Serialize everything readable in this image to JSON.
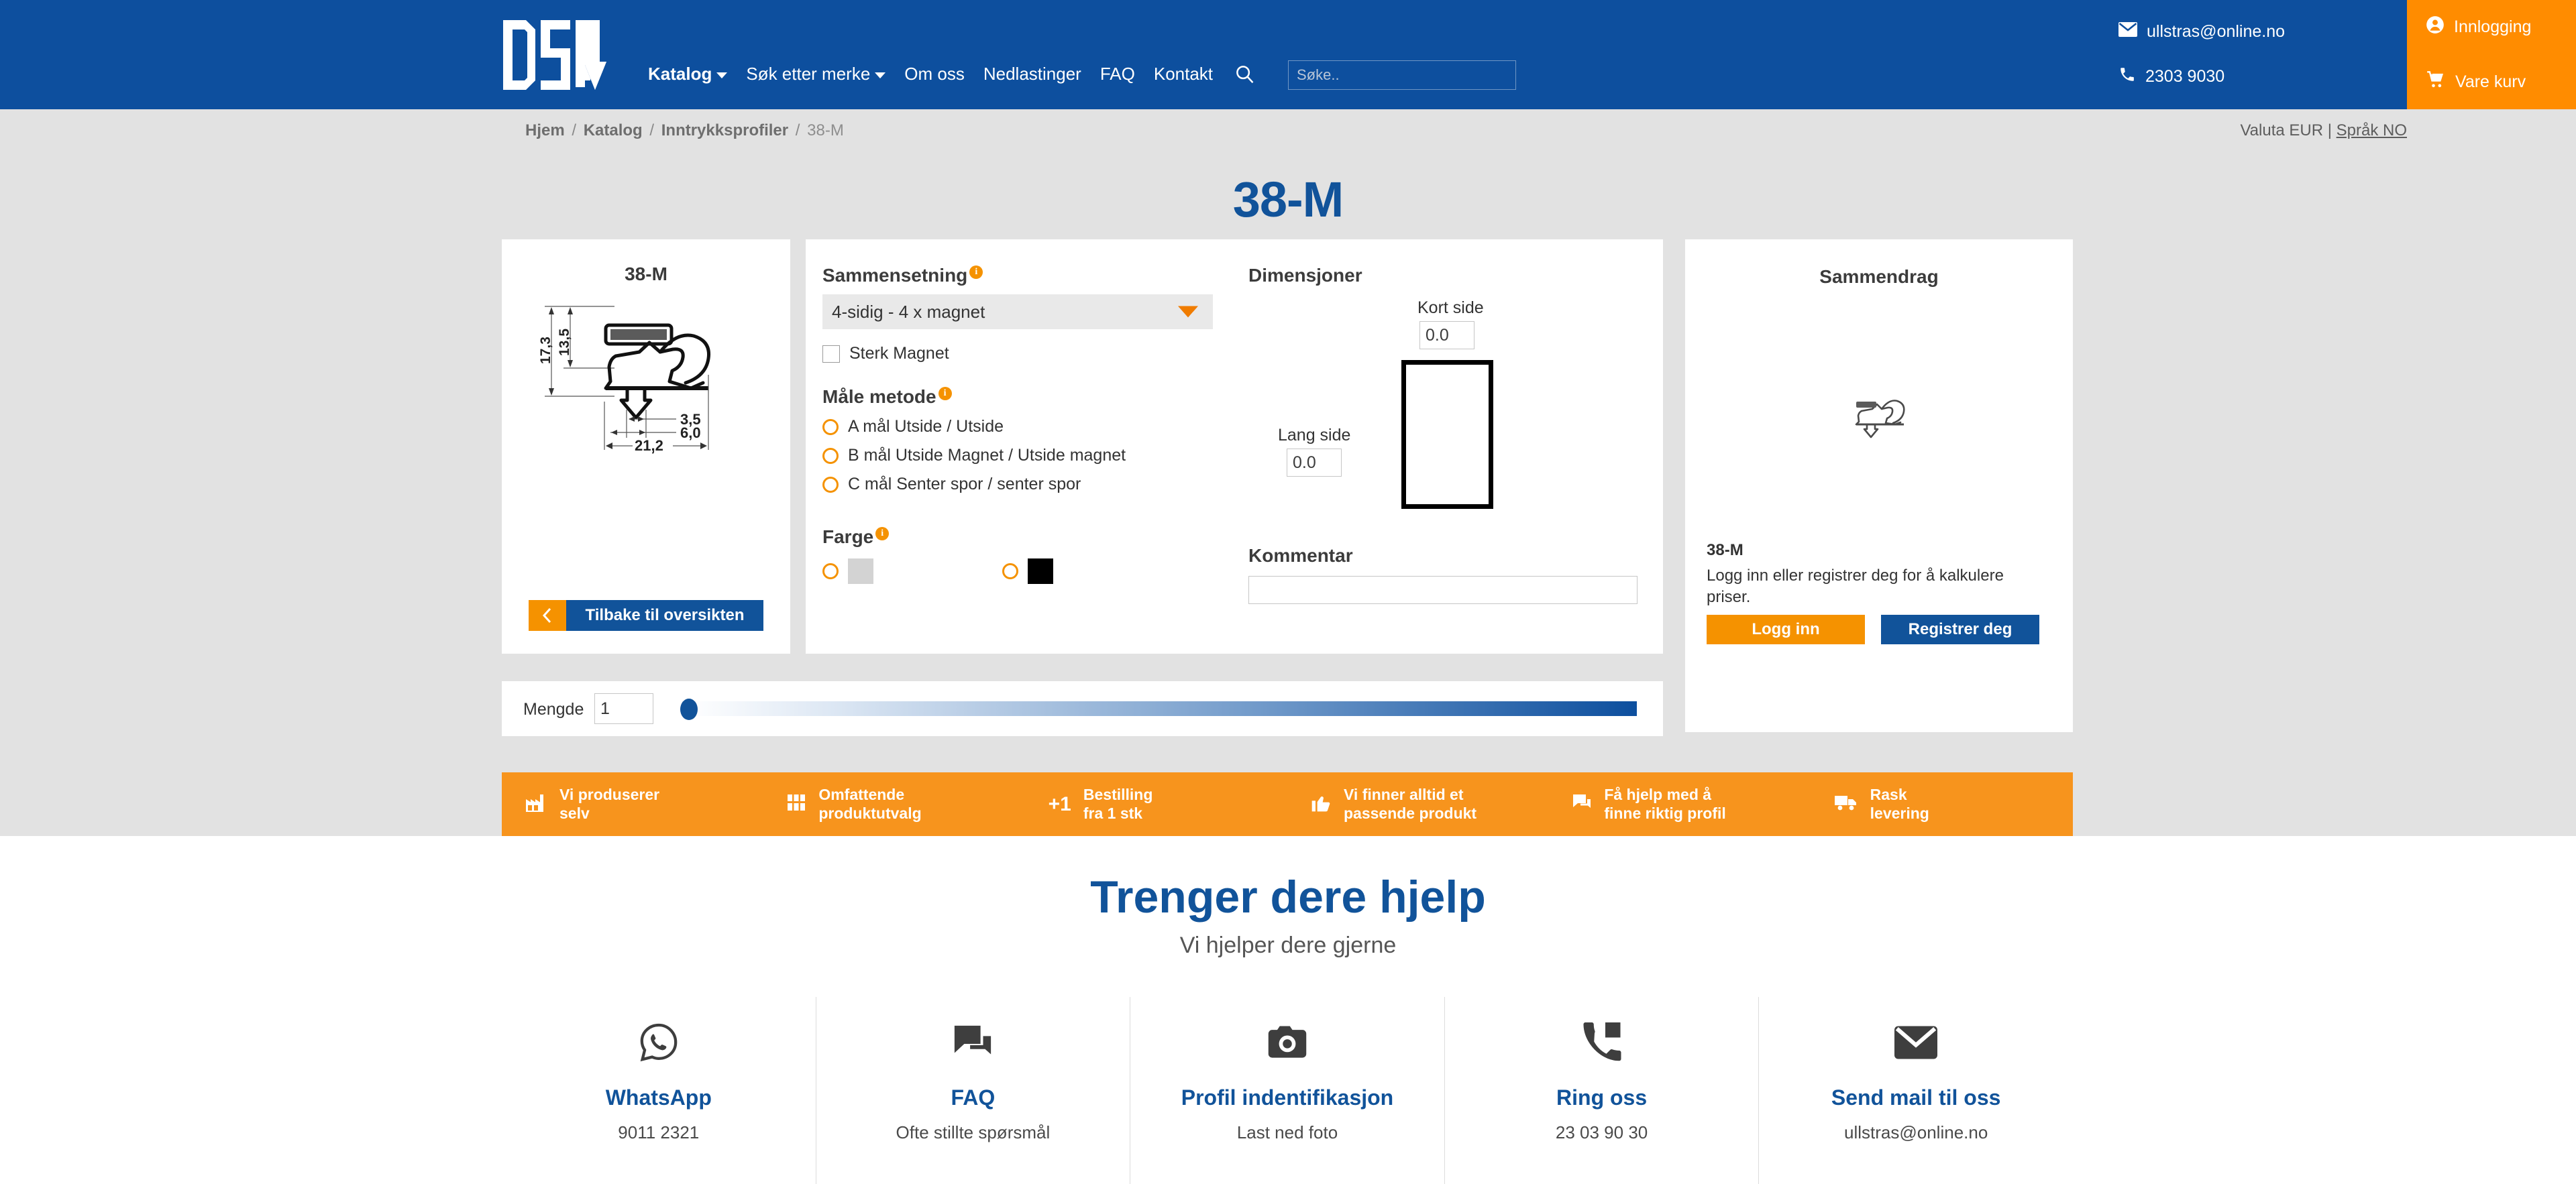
{
  "header": {
    "logo_text": "DSU",
    "nav": [
      {
        "label": "Katalog",
        "caret": true,
        "bold": true
      },
      {
        "label": "Søk etter merke",
        "caret": true,
        "bold": false
      },
      {
        "label": "Om oss",
        "caret": false,
        "bold": false
      },
      {
        "label": "Nedlastinger",
        "caret": false,
        "bold": false
      },
      {
        "label": "FAQ",
        "caret": false,
        "bold": false
      },
      {
        "label": "Kontakt",
        "caret": false,
        "bold": false
      }
    ],
    "search_placeholder": "Søke..",
    "search_value": "",
    "email": "ullstras@online.no",
    "phone": "2303 9030",
    "login_label": "Innlogging",
    "cart_label": "Vare kurv"
  },
  "breadcrumb": {
    "items": [
      "Hjem",
      "Katalog",
      "Inntrykksprofiler",
      "38-M"
    ],
    "separator": "/"
  },
  "locale": {
    "currency_label": "Valuta EUR",
    "divider": "|",
    "language_label": "Språk NO"
  },
  "page_title": "38-M",
  "drawing_card": {
    "title": "38-M",
    "dimensions": {
      "height_total": "17,3",
      "height_inner": "13,5",
      "width_small": "3,5",
      "width_mid": "6,0",
      "width_total": "21,2"
    },
    "back_button": "Tilbake til oversikten"
  },
  "config": {
    "composition": {
      "heading": "Sammensetning",
      "selected": "4-sidig - 4 x magnet"
    },
    "strong_magnet": {
      "label": "Sterk Magnet",
      "checked": false
    },
    "measure_method": {
      "heading": "Måle metode",
      "options": [
        "A mål Utside / Utside",
        "B mål Utside Magnet / Utside magnet",
        "C mål Senter spor / senter spor"
      ]
    },
    "color": {
      "heading": "Farge",
      "options": [
        {
          "name": "grey-swatch",
          "hex": "#d3d3d3"
        },
        {
          "name": "black-swatch",
          "hex": "#000000"
        }
      ]
    },
    "dimensions": {
      "heading": "Dimensjoner",
      "short_side_label": "Kort side",
      "short_side_value": "0.0",
      "long_side_label": "Lang side",
      "long_side_value": "0.0"
    },
    "comment": {
      "heading": "Kommentar",
      "value": ""
    }
  },
  "summary": {
    "heading": "Sammendrag",
    "product_code": "38-M",
    "note": "Logg inn eller registrer deg for å kalkulere priser.",
    "login_button": "Logg inn",
    "register_button": "Registrer deg"
  },
  "quantity": {
    "label": "Mengde",
    "value": "1",
    "slider_percent": 0
  },
  "usp_bar": [
    {
      "icon": "factory-icon",
      "line1": "Vi produserer",
      "line2": "selv"
    },
    {
      "icon": "grid-icon",
      "line1": "Omfattende",
      "line2": "produktutvalg"
    },
    {
      "icon": "plus-one-icon",
      "line1": "Bestilling",
      "line2": "fra 1 stk"
    },
    {
      "icon": "thumbs-up-icon",
      "line1": "Vi finner alltid et",
      "line2": "passende produkt"
    },
    {
      "icon": "chat-icon",
      "line1": "Få hjelp med å",
      "line2": "finne riktig profil"
    },
    {
      "icon": "truck-icon",
      "line1": "Rask",
      "line2": "levering"
    }
  ],
  "help": {
    "heading": "Trenger dere hjelp",
    "subheading": "Vi hjelper dere gjerne",
    "tiles": [
      {
        "icon": "whatsapp-icon",
        "name": "WhatsApp",
        "meta": "9011 2321"
      },
      {
        "icon": "chat-icon",
        "name": "FAQ",
        "meta": "Ofte stillte spørsmål"
      },
      {
        "icon": "camera-icon",
        "name": "Profil indentifikasjon",
        "meta": "Last ned foto"
      },
      {
        "icon": "phone-icon",
        "name": "Ring oss",
        "meta": "23 03 90 30"
      },
      {
        "icon": "mail-icon",
        "name": "Send mail til oss",
        "meta": "ullstras@online.no"
      }
    ]
  },
  "colors": {
    "brand_blue": "#0d4f9e",
    "accent_orange": "#f7941d",
    "page_bg": "#e2e2e2"
  }
}
